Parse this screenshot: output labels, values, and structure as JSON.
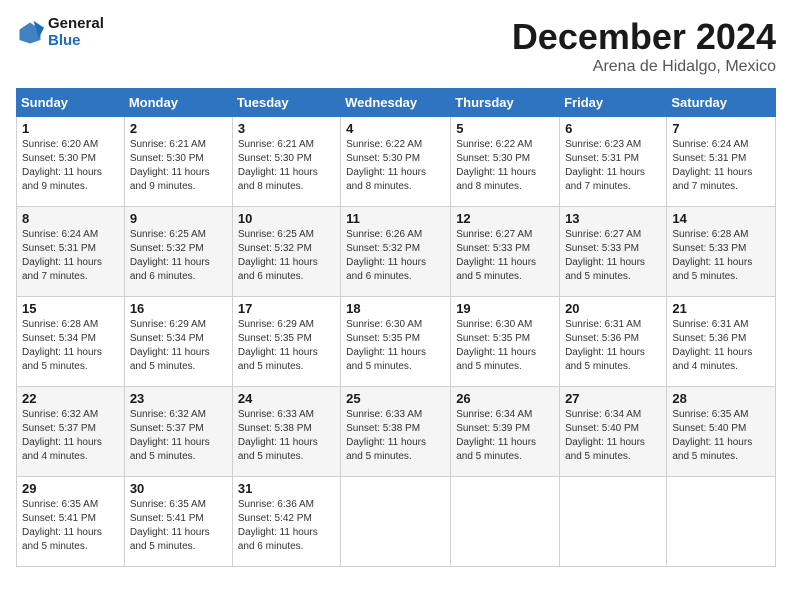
{
  "header": {
    "logo_line1": "General",
    "logo_line2": "Blue",
    "month_title": "December 2024",
    "location": "Arena de Hidalgo, Mexico"
  },
  "weekdays": [
    "Sunday",
    "Monday",
    "Tuesday",
    "Wednesday",
    "Thursday",
    "Friday",
    "Saturday"
  ],
  "weeks": [
    [
      {
        "day": "1",
        "info": "Sunrise: 6:20 AM\nSunset: 5:30 PM\nDaylight: 11 hours\nand 9 minutes."
      },
      {
        "day": "2",
        "info": "Sunrise: 6:21 AM\nSunset: 5:30 PM\nDaylight: 11 hours\nand 9 minutes."
      },
      {
        "day": "3",
        "info": "Sunrise: 6:21 AM\nSunset: 5:30 PM\nDaylight: 11 hours\nand 8 minutes."
      },
      {
        "day": "4",
        "info": "Sunrise: 6:22 AM\nSunset: 5:30 PM\nDaylight: 11 hours\nand 8 minutes."
      },
      {
        "day": "5",
        "info": "Sunrise: 6:22 AM\nSunset: 5:30 PM\nDaylight: 11 hours\nand 8 minutes."
      },
      {
        "day": "6",
        "info": "Sunrise: 6:23 AM\nSunset: 5:31 PM\nDaylight: 11 hours\nand 7 minutes."
      },
      {
        "day": "7",
        "info": "Sunrise: 6:24 AM\nSunset: 5:31 PM\nDaylight: 11 hours\nand 7 minutes."
      }
    ],
    [
      {
        "day": "8",
        "info": "Sunrise: 6:24 AM\nSunset: 5:31 PM\nDaylight: 11 hours\nand 7 minutes."
      },
      {
        "day": "9",
        "info": "Sunrise: 6:25 AM\nSunset: 5:32 PM\nDaylight: 11 hours\nand 6 minutes."
      },
      {
        "day": "10",
        "info": "Sunrise: 6:25 AM\nSunset: 5:32 PM\nDaylight: 11 hours\nand 6 minutes."
      },
      {
        "day": "11",
        "info": "Sunrise: 6:26 AM\nSunset: 5:32 PM\nDaylight: 11 hours\nand 6 minutes."
      },
      {
        "day": "12",
        "info": "Sunrise: 6:27 AM\nSunset: 5:33 PM\nDaylight: 11 hours\nand 5 minutes."
      },
      {
        "day": "13",
        "info": "Sunrise: 6:27 AM\nSunset: 5:33 PM\nDaylight: 11 hours\nand 5 minutes."
      },
      {
        "day": "14",
        "info": "Sunrise: 6:28 AM\nSunset: 5:33 PM\nDaylight: 11 hours\nand 5 minutes."
      }
    ],
    [
      {
        "day": "15",
        "info": "Sunrise: 6:28 AM\nSunset: 5:34 PM\nDaylight: 11 hours\nand 5 minutes."
      },
      {
        "day": "16",
        "info": "Sunrise: 6:29 AM\nSunset: 5:34 PM\nDaylight: 11 hours\nand 5 minutes."
      },
      {
        "day": "17",
        "info": "Sunrise: 6:29 AM\nSunset: 5:35 PM\nDaylight: 11 hours\nand 5 minutes."
      },
      {
        "day": "18",
        "info": "Sunrise: 6:30 AM\nSunset: 5:35 PM\nDaylight: 11 hours\nand 5 minutes."
      },
      {
        "day": "19",
        "info": "Sunrise: 6:30 AM\nSunset: 5:35 PM\nDaylight: 11 hours\nand 5 minutes."
      },
      {
        "day": "20",
        "info": "Sunrise: 6:31 AM\nSunset: 5:36 PM\nDaylight: 11 hours\nand 5 minutes."
      },
      {
        "day": "21",
        "info": "Sunrise: 6:31 AM\nSunset: 5:36 PM\nDaylight: 11 hours\nand 4 minutes."
      }
    ],
    [
      {
        "day": "22",
        "info": "Sunrise: 6:32 AM\nSunset: 5:37 PM\nDaylight: 11 hours\nand 4 minutes."
      },
      {
        "day": "23",
        "info": "Sunrise: 6:32 AM\nSunset: 5:37 PM\nDaylight: 11 hours\nand 5 minutes."
      },
      {
        "day": "24",
        "info": "Sunrise: 6:33 AM\nSunset: 5:38 PM\nDaylight: 11 hours\nand 5 minutes."
      },
      {
        "day": "25",
        "info": "Sunrise: 6:33 AM\nSunset: 5:38 PM\nDaylight: 11 hours\nand 5 minutes."
      },
      {
        "day": "26",
        "info": "Sunrise: 6:34 AM\nSunset: 5:39 PM\nDaylight: 11 hours\nand 5 minutes."
      },
      {
        "day": "27",
        "info": "Sunrise: 6:34 AM\nSunset: 5:40 PM\nDaylight: 11 hours\nand 5 minutes."
      },
      {
        "day": "28",
        "info": "Sunrise: 6:35 AM\nSunset: 5:40 PM\nDaylight: 11 hours\nand 5 minutes."
      }
    ],
    [
      {
        "day": "29",
        "info": "Sunrise: 6:35 AM\nSunset: 5:41 PM\nDaylight: 11 hours\nand 5 minutes."
      },
      {
        "day": "30",
        "info": "Sunrise: 6:35 AM\nSunset: 5:41 PM\nDaylight: 11 hours\nand 5 minutes."
      },
      {
        "day": "31",
        "info": "Sunrise: 6:36 AM\nSunset: 5:42 PM\nDaylight: 11 hours\nand 6 minutes."
      },
      null,
      null,
      null,
      null
    ]
  ]
}
